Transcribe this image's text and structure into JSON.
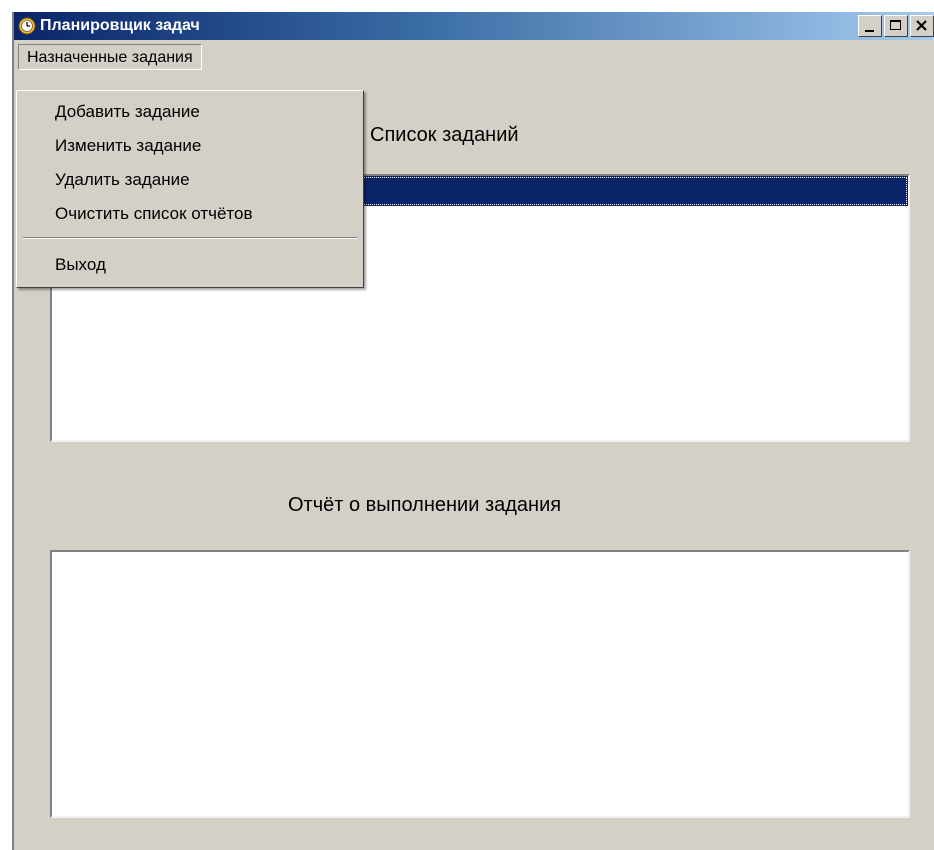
{
  "window": {
    "title": "Планировщик задач",
    "icon": "clock-icon"
  },
  "menubar": {
    "items": [
      {
        "label": "Назначенные задания"
      }
    ]
  },
  "dropdown": {
    "items": [
      {
        "label": "Добавить задание"
      },
      {
        "label": "Изменить задание"
      },
      {
        "label": "Удалить задание"
      },
      {
        "label": "Очистить список отчётов"
      },
      {
        "label": "Выход"
      }
    ]
  },
  "main": {
    "task_list_caption": "Список заданий",
    "report_caption": "Отчёт о выполнении задания"
  },
  "colors": {
    "titlebar_start": "#0a246a",
    "titlebar_end": "#a6caf0",
    "selection": "#0a246a",
    "face": "#d4d0c8"
  }
}
